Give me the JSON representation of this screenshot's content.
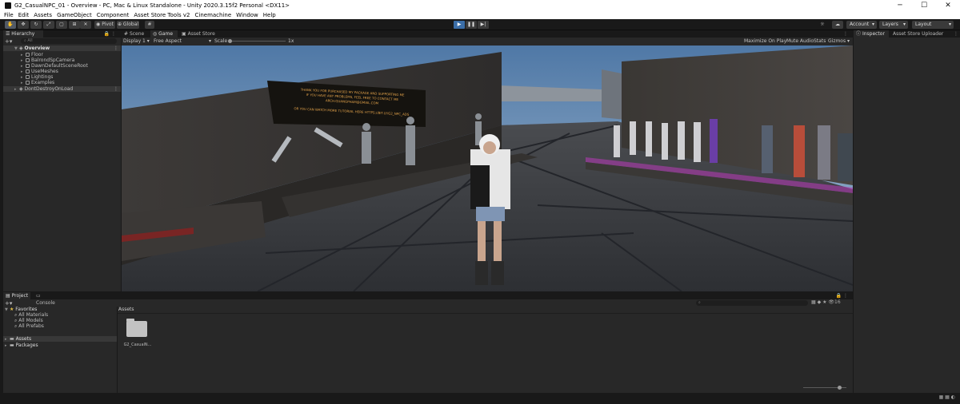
{
  "window": {
    "title": "G2_CasualNPC_01 - Overview - PC, Mac & Linux Standalone - Unity 2020.3.15f2 Personal <DX11>",
    "minimize": "─",
    "maximize": "☐",
    "close": "✕"
  },
  "menu": [
    "File",
    "Edit",
    "Assets",
    "GameObject",
    "Component",
    "Asset Store Tools v2",
    "Cinemachine",
    "Window",
    "Help"
  ],
  "toolbar": {
    "pivot": "Pivot",
    "global": "Global",
    "account": "Account",
    "layers": "Layers",
    "layout": "Layout",
    "play_state": "playing"
  },
  "hierarchy": {
    "tab": "Hierarchy",
    "search_placeholder": "All",
    "scene": "Overview",
    "items": [
      "Floor",
      "BalrondSpCamera",
      "DawnDefaultSceneRoot",
      "UseMeshes",
      "Lightings",
      "Examples"
    ],
    "dont_destroy": "DontDestroyOnLoad"
  },
  "center_tabs": [
    "Scene",
    "Game",
    "Asset Store"
  ],
  "game_bar": {
    "display": "Display 1",
    "aspect": "Free Aspect",
    "scale_label": "Scale",
    "scale_value": "1x",
    "maximize_on_play": "Maximize On Play",
    "mute_audio": "Mute Audio",
    "stats": "Stats",
    "gizmos": "Gizmos"
  },
  "signboard": {
    "line1": "THANK YOU FOR PURCHASED MY PACKAGE AND SUPPORTING ME",
    "line2": "IF YOU HAVE ANY PROBLEMS, FEEL FREE TO CONTACT ME",
    "line3": "ARCH.QUANGPHAM@GMAIL.COM",
    "line4": "OR YOU CAN WATCH MORE TUTORIAL HERE HTTPS://BIT.LY/G2_NPC_ADS"
  },
  "inspector_tabs": [
    "Inspector",
    "Asset Store Uploader"
  ],
  "project": {
    "tabs": [
      "Project",
      "Console"
    ],
    "favorites_label": "Favorites",
    "favorites": [
      "All Materials",
      "All Models",
      "All Prefabs"
    ],
    "assets_label": "Assets",
    "packages_label": "Packages",
    "breadcrumb": "Assets",
    "folder_name": "G2_CasualN...",
    "hidden_count": "16"
  },
  "colors": {
    "selected": "#2c5d87",
    "play_on": "#3b6ea8",
    "panel": "#282828",
    "toolbar": "#191919"
  }
}
